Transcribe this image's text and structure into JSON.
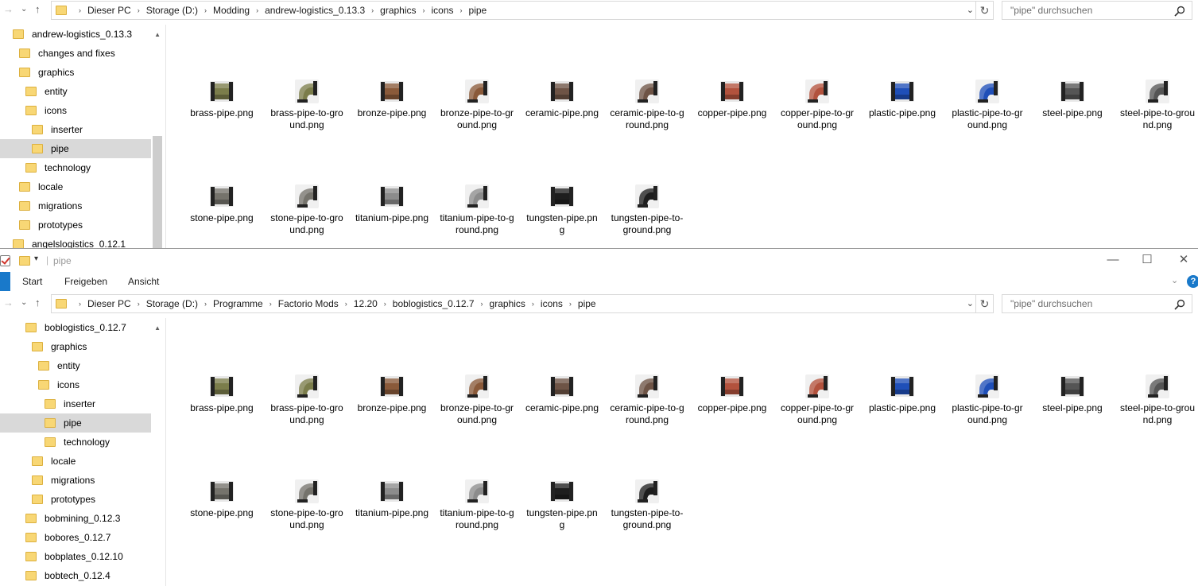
{
  "windows": [
    {
      "id": "top",
      "path": [
        "Dieser PC",
        "Storage (D:)",
        "Modding",
        "andrew-logistics_0.13.3",
        "graphics",
        "icons",
        "pipe"
      ],
      "search_placeholder": "\"pipe\" durchsuchen",
      "nav_items": [
        {
          "label": "andrew-logistics_0.13.3",
          "level": 0
        },
        {
          "label": "changes and fixes",
          "level": 1
        },
        {
          "label": "graphics",
          "level": 1
        },
        {
          "label": "entity",
          "level": 2
        },
        {
          "label": "icons",
          "level": 2
        },
        {
          "label": "inserter",
          "level": 3
        },
        {
          "label": "pipe",
          "level": 3,
          "selected": true
        },
        {
          "label": "technology",
          "level": 2
        },
        {
          "label": "locale",
          "level": 1
        },
        {
          "label": "migrations",
          "level": 1
        },
        {
          "label": "prototypes",
          "level": 1
        },
        {
          "label": "angelslogistics_0.12.1",
          "level": 0
        }
      ]
    },
    {
      "id": "bottom",
      "title": "pipe",
      "ribbon_tabs": [
        "Start",
        "Freigeben",
        "Ansicht"
      ],
      "path": [
        "Dieser PC",
        "Storage (D:)",
        "Programme",
        "Factorio Mods",
        "12.20",
        "boblogistics_0.12.7",
        "graphics",
        "icons",
        "pipe"
      ],
      "search_placeholder": "\"pipe\" durchsuchen",
      "nav_items": [
        {
          "label": "boblogistics_0.12.7",
          "level": 0
        },
        {
          "label": "graphics",
          "level": 1
        },
        {
          "label": "entity",
          "level": 2
        },
        {
          "label": "icons",
          "level": 2
        },
        {
          "label": "inserter",
          "level": 3
        },
        {
          "label": "pipe",
          "level": 3,
          "selected": true
        },
        {
          "label": "technology",
          "level": 3
        },
        {
          "label": "locale",
          "level": 1
        },
        {
          "label": "migrations",
          "level": 1
        },
        {
          "label": "prototypes",
          "level": 1
        },
        {
          "label": "bobmining_0.12.3",
          "level": 0
        },
        {
          "label": "bobores_0.12.7",
          "level": 0
        },
        {
          "label": "bobplates_0.12.10",
          "level": 0
        },
        {
          "label": "bobtech_0.12.4",
          "level": 0
        }
      ]
    }
  ],
  "files": [
    {
      "name": "brass-pipe.png",
      "shape": "straight",
      "color": "#7b7d4b"
    },
    {
      "name": "brass-pipe-to-ground.png",
      "shape": "elbow",
      "color": "#7b7d4b"
    },
    {
      "name": "bronze-pipe.png",
      "shape": "straight",
      "color": "#8a5a3a"
    },
    {
      "name": "bronze-pipe-to-ground.png",
      "shape": "elbow",
      "color": "#8a5a3a"
    },
    {
      "name": "ceramic-pipe.png",
      "shape": "straight",
      "color": "#6e5446"
    },
    {
      "name": "ceramic-pipe-to-ground.png",
      "shape": "elbow",
      "color": "#6e5446"
    },
    {
      "name": "copper-pipe.png",
      "shape": "straight",
      "color": "#b2523d"
    },
    {
      "name": "copper-pipe-to-ground.png",
      "shape": "elbow",
      "color": "#b2523d"
    },
    {
      "name": "plastic-pipe.png",
      "shape": "straight",
      "color": "#1f4fb8"
    },
    {
      "name": "plastic-pipe-to-ground.png",
      "shape": "elbow",
      "color": "#1f4fb8"
    },
    {
      "name": "steel-pipe.png",
      "shape": "straight",
      "color": "#555555"
    },
    {
      "name": "steel-pipe-to-ground.png",
      "shape": "elbow",
      "color": "#555555"
    },
    {
      "name": "stone-pipe.png",
      "shape": "straight",
      "color": "#75736c"
    },
    {
      "name": "stone-pipe-to-ground.png",
      "shape": "elbow",
      "color": "#75736c"
    },
    {
      "name": "titanium-pipe.png",
      "shape": "straight",
      "color": "#8c8c8c"
    },
    {
      "name": "titanium-pipe-to-ground.png",
      "shape": "elbow",
      "color": "#8c8c8c"
    },
    {
      "name": "tungsten-pipe.png",
      "shape": "straight",
      "color": "#1e1e1e"
    },
    {
      "name": "tungsten-pipe-to-ground.png",
      "shape": "elbow",
      "color": "#1e1e1e"
    }
  ]
}
